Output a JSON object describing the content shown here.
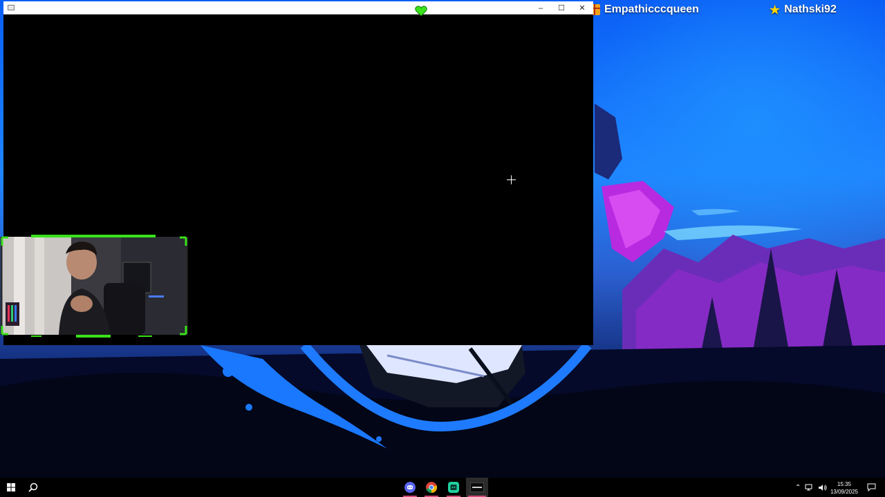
{
  "overlay": {
    "gift_user": "Empathicccqueen",
    "follower_user": "Nathski92",
    "gift_icon": "gift-icon",
    "star_icon": "star-icon",
    "heart_icon": "green-heart-icon"
  },
  "window": {
    "title": "",
    "minimize": "–",
    "maximize": "☐",
    "close": "✕"
  },
  "taskbar": {
    "apps": [
      {
        "name": "discord-icon"
      },
      {
        "name": "chrome-icon"
      },
      {
        "name": "stream-app-icon"
      },
      {
        "name": "terminal-icon"
      }
    ],
    "time": "15:35",
    "date": "13/09/2025"
  },
  "colors": {
    "accent_green": "#39e21a",
    "wallpaper_blue": "#0d6bff",
    "wallpaper_magenta": "#b41bd6",
    "taskbar_active": "#d24a7a"
  }
}
